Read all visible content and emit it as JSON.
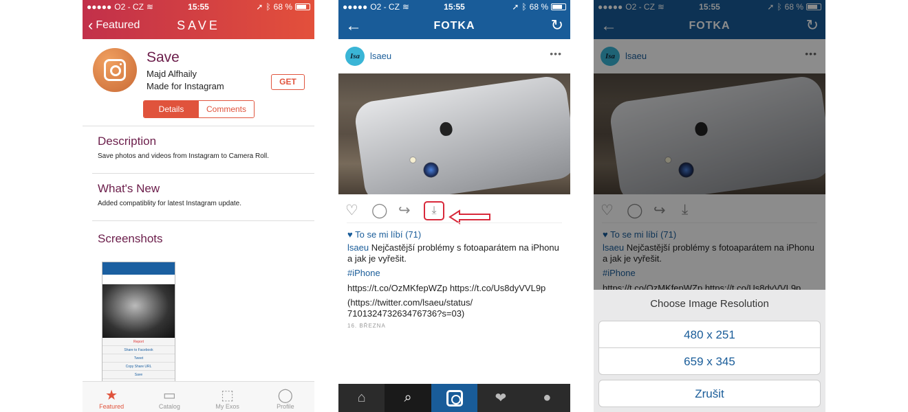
{
  "status": {
    "carrier": "O2 - CZ",
    "time": "15:55",
    "battery": "68 %"
  },
  "phone1": {
    "back_label": "Featured",
    "logo": "SAVE",
    "app": {
      "name": "Save",
      "developer": "Majd Alfhaily",
      "subtitle": "Made for Instagram",
      "get_label": "GET"
    },
    "segments": [
      "Details",
      "Comments"
    ],
    "description": {
      "title": "Description",
      "text": "Save photos and videos from Instagram to Camera Roll."
    },
    "whats_new": {
      "title": "What's New",
      "text": "Added compatiblity for latest Instagram update."
    },
    "screenshots_title": "Screenshots",
    "mini_sheet": [
      "Report",
      "Share to Facebook",
      "Tweet",
      "Copy Share URL",
      "Save"
    ],
    "tabs": [
      {
        "label": "Featured",
        "icon": "star-icon"
      },
      {
        "label": "Catalog",
        "icon": "catalog-icon"
      },
      {
        "label": "My Exos",
        "icon": "box-icon"
      },
      {
        "label": "Profile",
        "icon": "profile-icon"
      }
    ]
  },
  "instagram": {
    "title": "FOTKA",
    "avatar_text": "Isa",
    "username": "lsaeu",
    "likes": "To se mi líbí (71)",
    "caption_user": "lsaeu",
    "caption_text": "Nejčastější problémy s fotoaparátem na iPhonu a jak je vyřešit.",
    "hashtag": "#iPhone",
    "links": "https://t.co/OzMKfepWZp https://t.co/Us8dyVVL9p",
    "twitter": "(https://twitter.com/lsaeu/status/ 710132473263476736?s=03)",
    "date": "16. BŘEZNA"
  },
  "resolution_sheet": {
    "title": "Choose Image Resolution",
    "options": [
      "480 x 251",
      "659 x 345"
    ],
    "cancel": "Zrušit"
  },
  "colors": {
    "save_red": "#e0533c",
    "ig_blue": "#195c99",
    "highlight_red": "#d8283a"
  }
}
